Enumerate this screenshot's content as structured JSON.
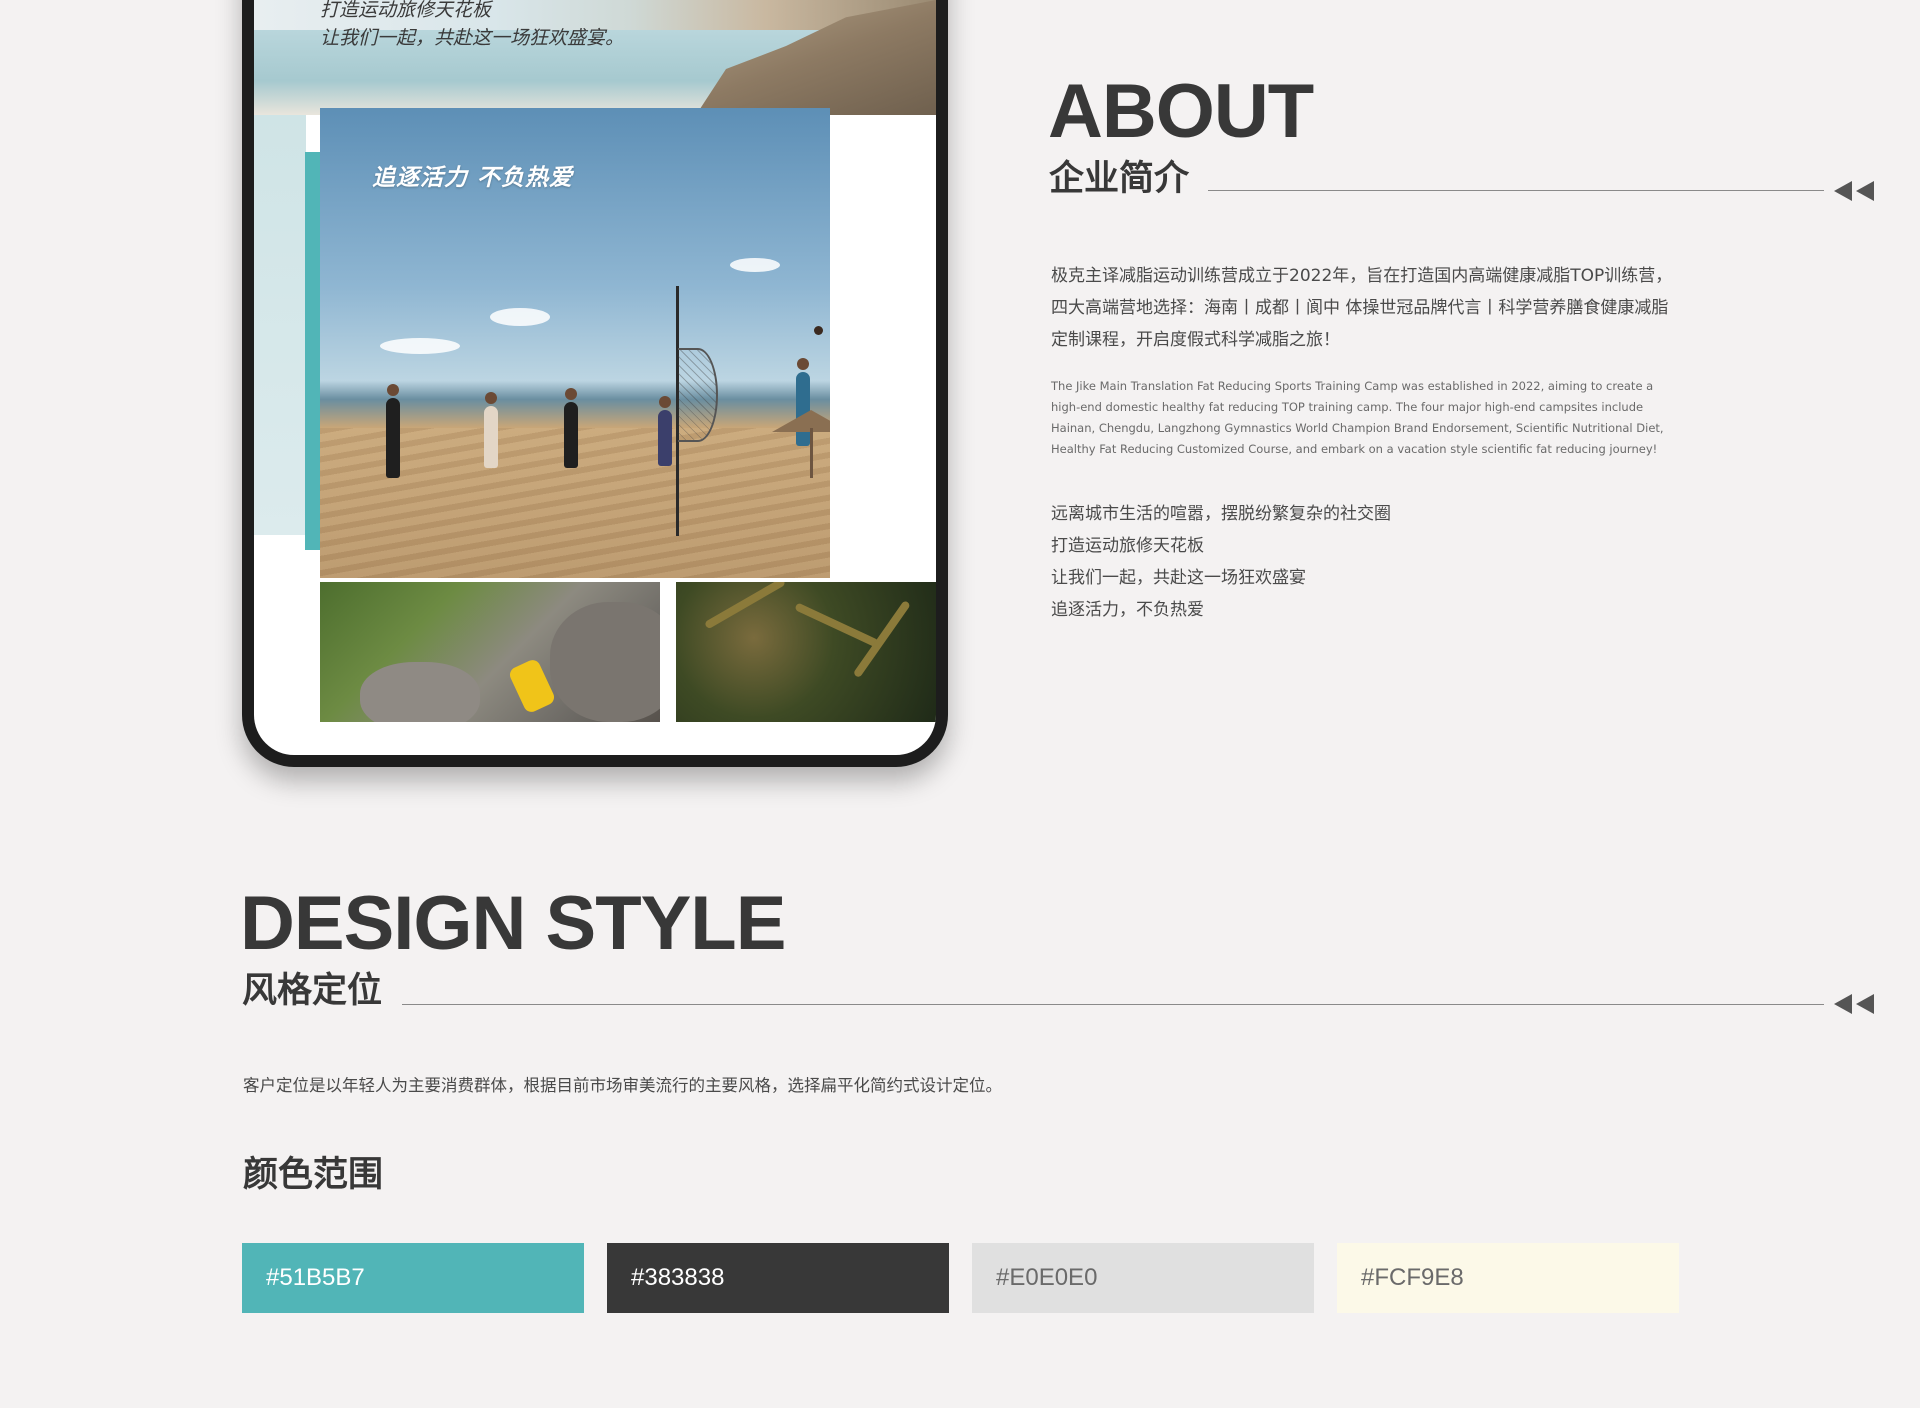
{
  "phone": {
    "top_caption_line1": "打造运动旅修天花板",
    "top_caption_line2": "让我们一起，共赴这一场狂欢盛宴。",
    "hero_title": "追逐活力 不负热爱"
  },
  "about": {
    "title": "ABOUT",
    "subtitle": "企业简介",
    "description_cn": "极克主译减脂运动训练营成立于2022年，旨在打造国内高端健康减脂TOP训练营，四大高端营地选择：海南丨成都丨阆中 体操世冠品牌代言丨科学营养膳食健康减脂定制课程，开启度假式科学减脂之旅！",
    "description_en": "The Jike Main Translation Fat Reducing Sports Training Camp was established in 2022, aiming to create a high-end domestic healthy fat reducing TOP training camp. The four major high-end campsites include Hainan, Chengdu, Langzhong Gymnastics World Champion Brand Endorsement, Scientific Nutritional Diet, Healthy Fat Reducing Customized Course, and embark on a vacation style scientific fat reducing journey!",
    "lines": [
      "远离城市生活的喧嚣，摆脱纷繁复杂的社交圈",
      "打造运动旅修天花板",
      "让我们一起，共赴这一场狂欢盛宴",
      "追逐活力，不负热爱"
    ]
  },
  "design_style": {
    "title": "DESIGN STYLE",
    "subtitle": "风格定位",
    "description": "客户定位是以年轻人为主要消费群体，根据目前市场审美流行的主要风格，选择扁平化简约式设计定位。",
    "color_range_title": "颜色范围",
    "swatches": [
      {
        "label": "#51B5B7",
        "color": "#51B5B7",
        "text_color": "#ffffff"
      },
      {
        "label": "#383838",
        "color": "#383838",
        "text_color": "#ffffff"
      },
      {
        "label": "#E0E0E0",
        "color": "#E0E0E0",
        "text_color": "#6a6a6a"
      },
      {
        "label": "#FCF9E8",
        "color": "#FCF9E8",
        "text_color": "#6a6a6a"
      }
    ]
  },
  "icons": {
    "section_marker": "double-left-arrow-icon"
  }
}
